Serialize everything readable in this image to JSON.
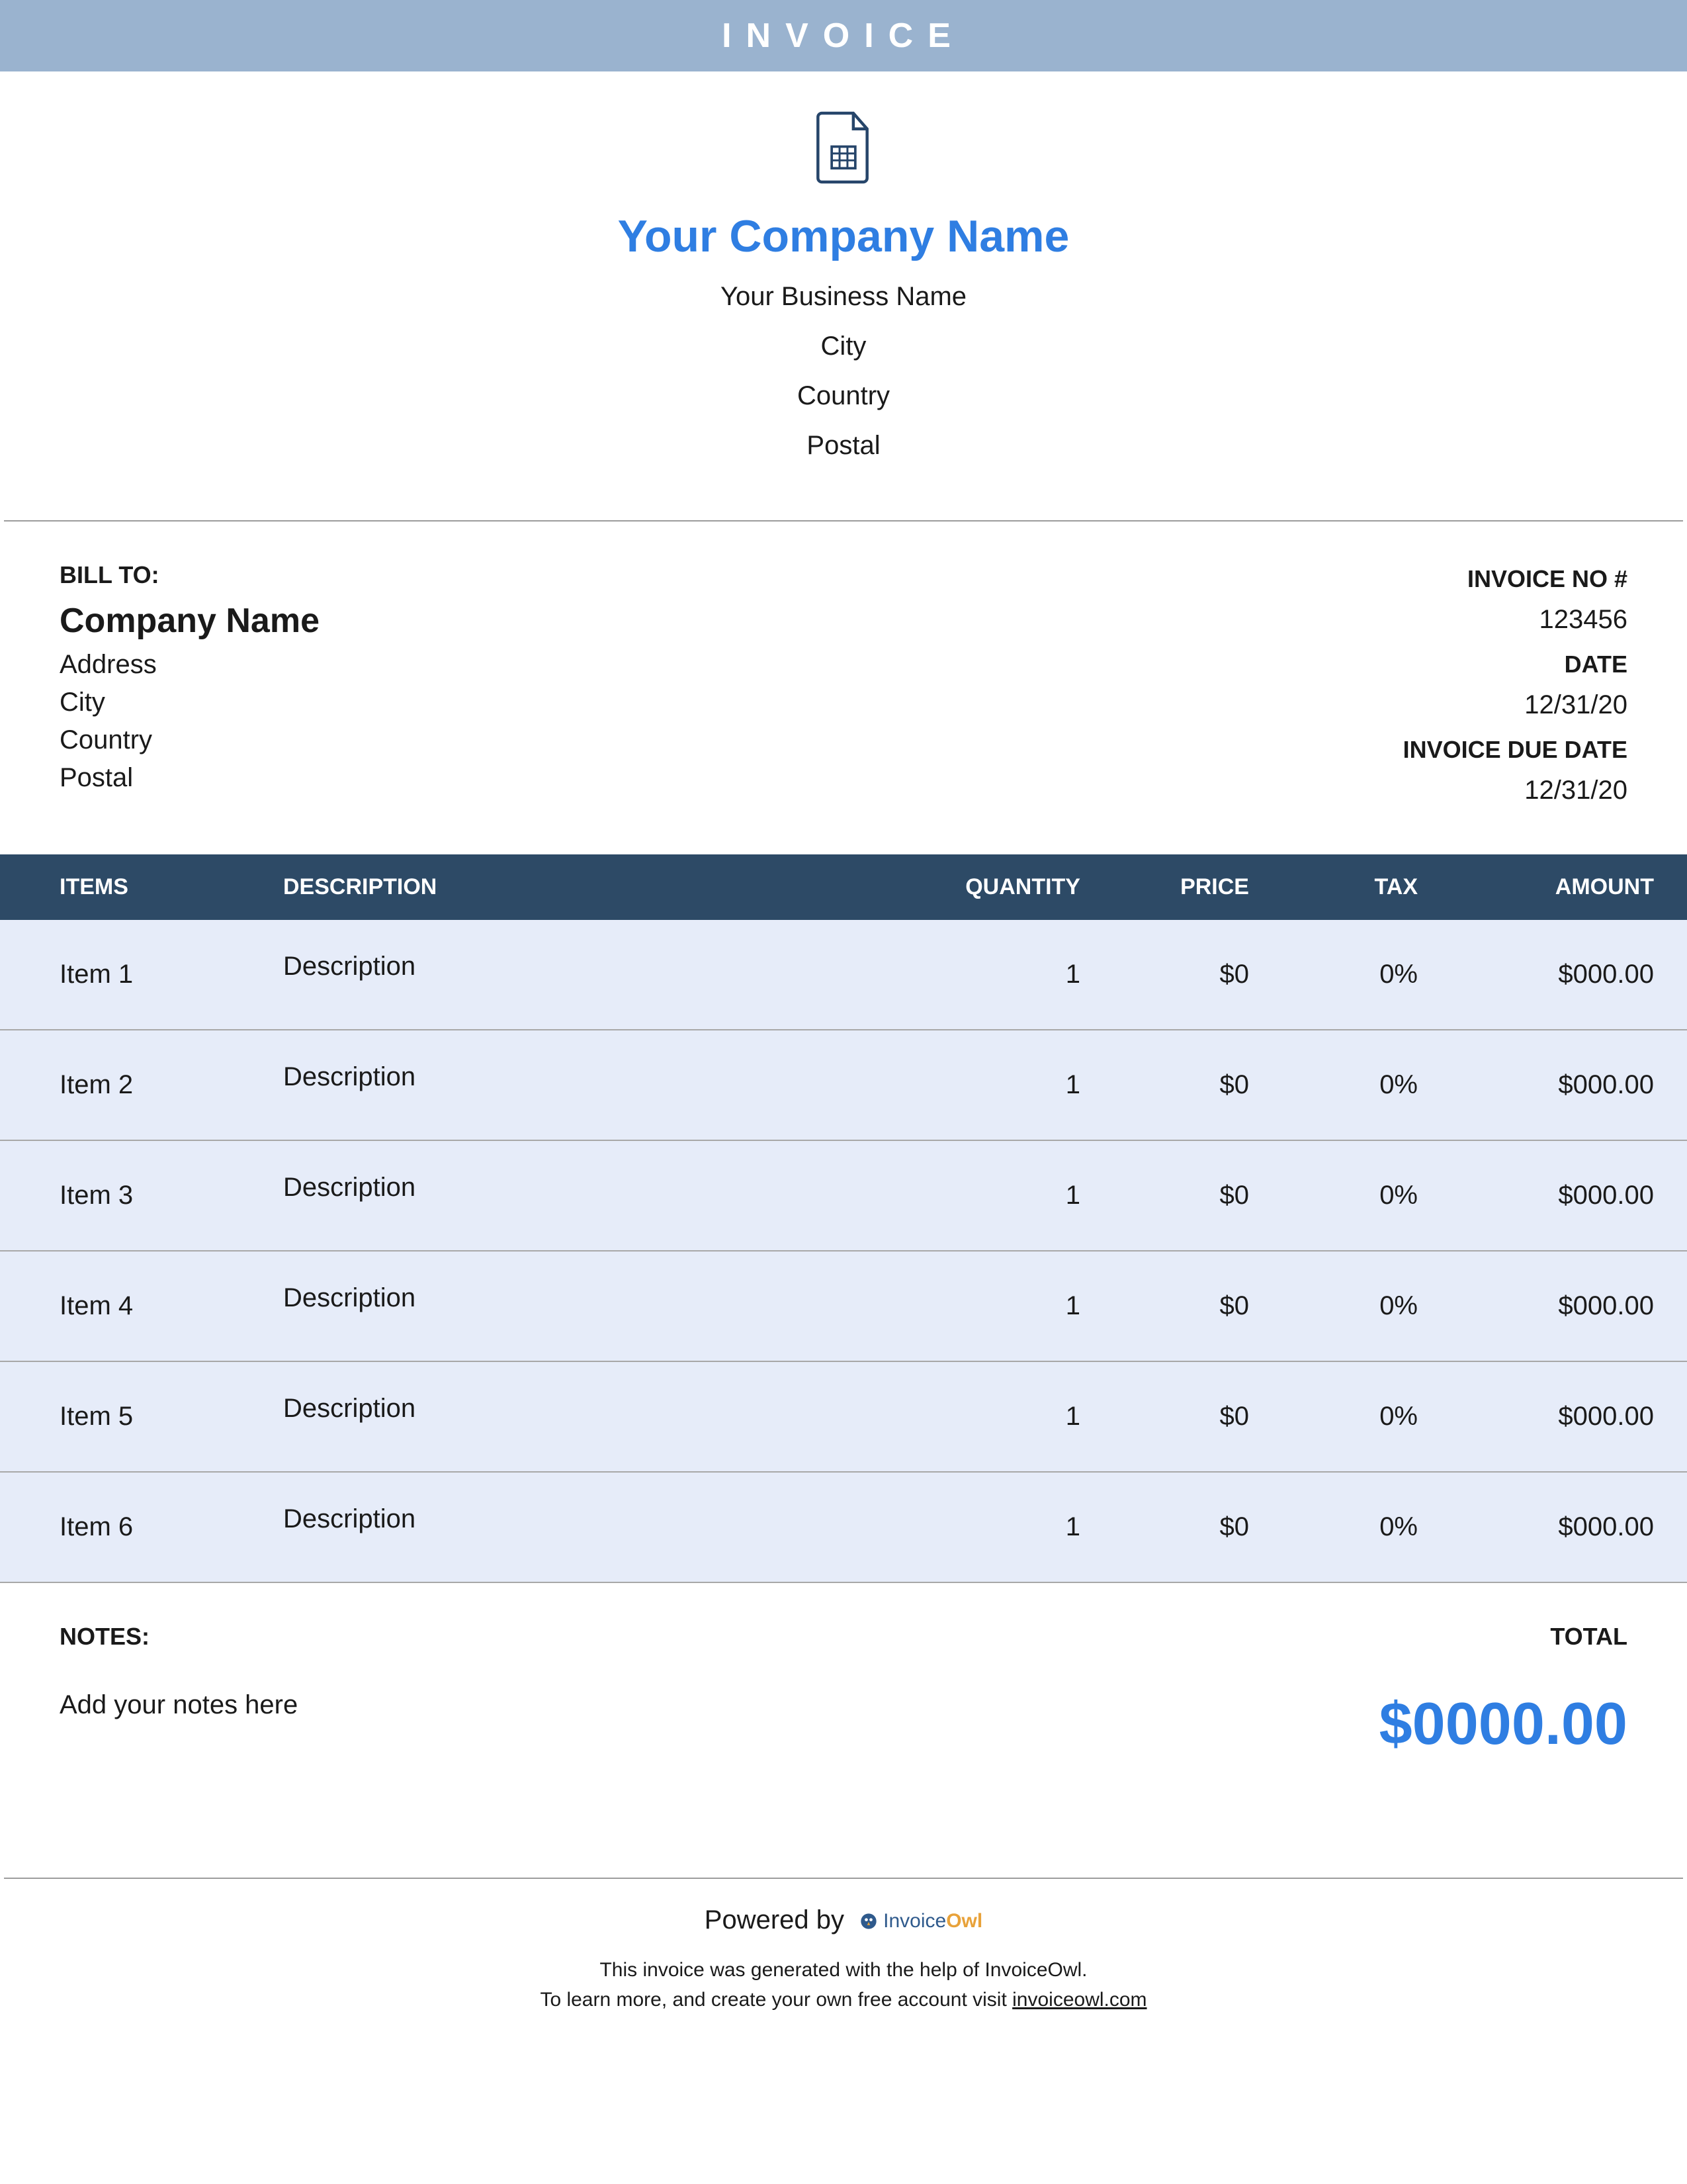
{
  "banner": "INVOICE",
  "company": {
    "name": "Your Company Name",
    "business": "Your Business Name",
    "city": "City",
    "country": "Country",
    "postal": "Postal"
  },
  "bill_to": {
    "label": "BILL TO:",
    "company": "Company Name",
    "address": "Address",
    "city": "City",
    "country": "Country",
    "postal": "Postal"
  },
  "meta": {
    "invoice_no_label": "INVOICE NO #",
    "invoice_no": "123456",
    "date_label": "DATE",
    "date": "12/31/20",
    "due_label": "INVOICE DUE DATE",
    "due": "12/31/20"
  },
  "columns": {
    "items": "ITEMS",
    "description": "DESCRIPTION",
    "quantity": "QUANTITY",
    "price": "PRICE",
    "tax": "TAX",
    "amount": "AMOUNT"
  },
  "rows": [
    {
      "item": "Item 1",
      "description": "Description",
      "quantity": "1",
      "price": "$0",
      "tax": "0%",
      "amount": "$000.00"
    },
    {
      "item": "Item 2",
      "description": "Description",
      "quantity": "1",
      "price": "$0",
      "tax": "0%",
      "amount": "$000.00"
    },
    {
      "item": "Item 3",
      "description": "Description",
      "quantity": "1",
      "price": "$0",
      "tax": "0%",
      "amount": "$000.00"
    },
    {
      "item": "Item 4",
      "description": "Description",
      "quantity": "1",
      "price": "$0",
      "tax": "0%",
      "amount": "$000.00"
    },
    {
      "item": "Item 5",
      "description": "Description",
      "quantity": "1",
      "price": "$0",
      "tax": "0%",
      "amount": "$000.00"
    },
    {
      "item": "Item 6",
      "description": "Description",
      "quantity": "1",
      "price": "$0",
      "tax": "0%",
      "amount": "$000.00"
    }
  ],
  "notes": {
    "label": "NOTES:",
    "text": "Add your notes here"
  },
  "total": {
    "label": "TOTAL",
    "value": "$0000.00"
  },
  "footer": {
    "powered_by": "Powered by",
    "brand_invoice": "Invoice",
    "brand_owl": "Owl",
    "line1": "This invoice was generated with the help of InvoiceOwl.",
    "line2a": "To learn more, and create your own free account visit ",
    "link": "invoiceowl.com"
  }
}
